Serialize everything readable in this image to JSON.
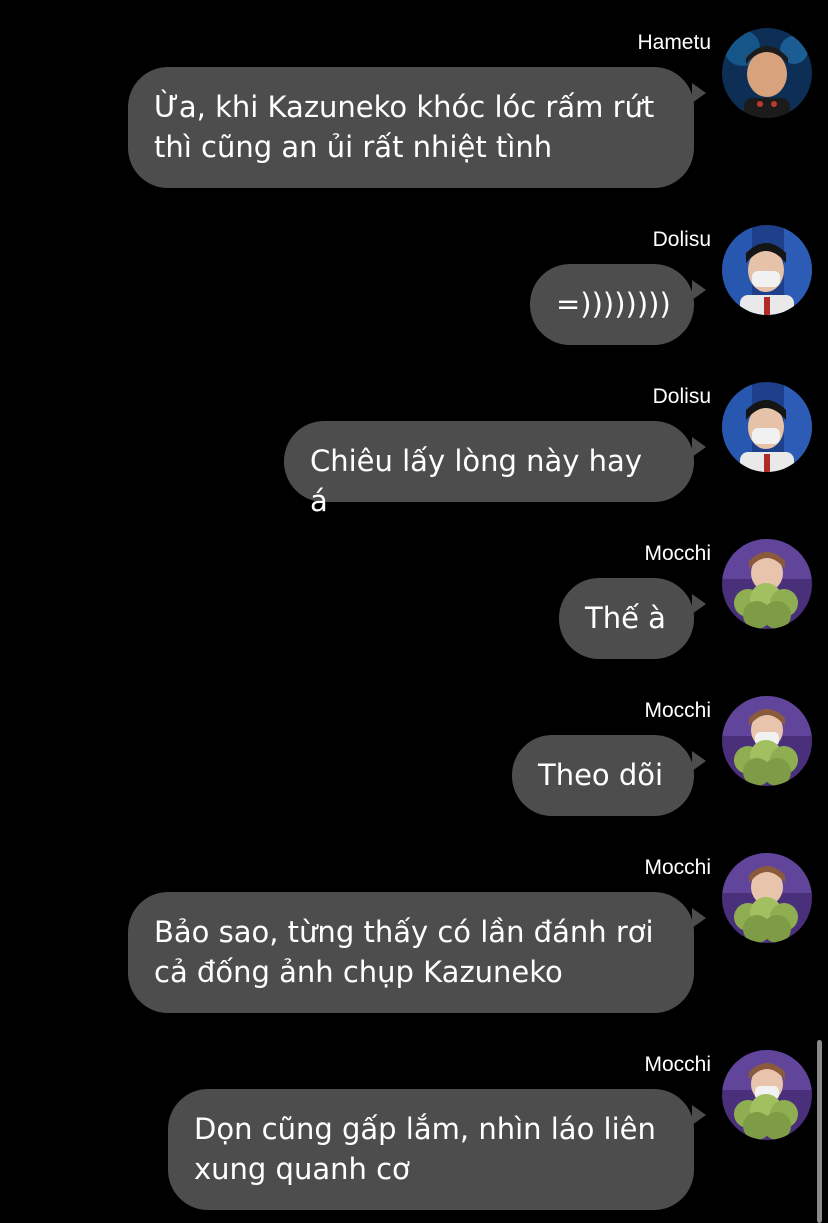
{
  "messages": [
    {
      "sender": "Hametu",
      "text": "Ừa, khi Kazuneko khóc lóc rấm rứt\nthì cũng an ủi rất nhiệt tình",
      "avatar": "avatar-hametu"
    },
    {
      "sender": "Dolisu",
      "text": "=))))))))",
      "avatar": "avatar-dolisu"
    },
    {
      "sender": "Dolisu",
      "text": "Chiêu lấy lòng này hay á",
      "avatar": "avatar-dolisu"
    },
    {
      "sender": "Mocchi",
      "text": "Thế à",
      "avatar": "avatar-mocchi"
    },
    {
      "sender": "Mocchi",
      "text": "Theo dõi",
      "avatar": "avatar-mocchi"
    },
    {
      "sender": "Mocchi",
      "text": "Bảo sao, từng thấy có lần đánh rơi\ncả đống ảnh chụp Kazuneko",
      "avatar": "avatar-mocchi"
    },
    {
      "sender": "Mocchi",
      "text": "Dọn cũng gấp lắm, nhìn láo liên\nxung quanh cơ",
      "avatar": "avatar-mocchi"
    }
  ],
  "colors": {
    "background": "#000000",
    "bubble": "#4d4d4e",
    "text": "#ffffff"
  }
}
